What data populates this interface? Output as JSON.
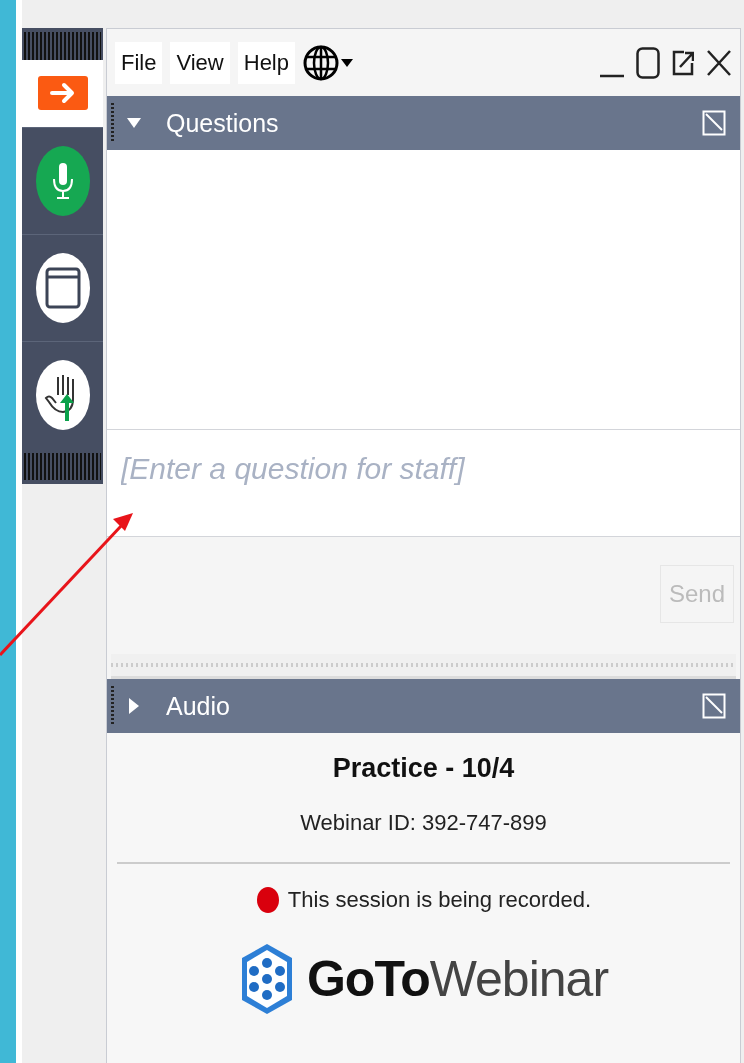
{
  "menu": [
    {
      "label": "File"
    },
    {
      "label": "View"
    },
    {
      "label": "Help"
    }
  ],
  "sidebar": {
    "items": [
      {
        "kind": "exit",
        "selected": true
      },
      {
        "kind": "microphone",
        "selected": false
      },
      {
        "kind": "window",
        "selected": false
      },
      {
        "kind": "hand",
        "selected": false
      }
    ]
  },
  "questions_panel": {
    "title": "Questions",
    "expanded": true,
    "input": {
      "placeholder": "[Enter a question for staff]"
    },
    "send_button": {
      "label": "Send",
      "disabled": true
    }
  },
  "audio_panel": {
    "title": "Audio",
    "expanded": false
  },
  "session": {
    "title": "Practice - 10/4",
    "webinar_id": "Webinar ID: 392-747-899",
    "recording": true,
    "recording_notice": "This session is being recorded.",
    "logo_text": "**GoTo**Webinar"
  }
}
